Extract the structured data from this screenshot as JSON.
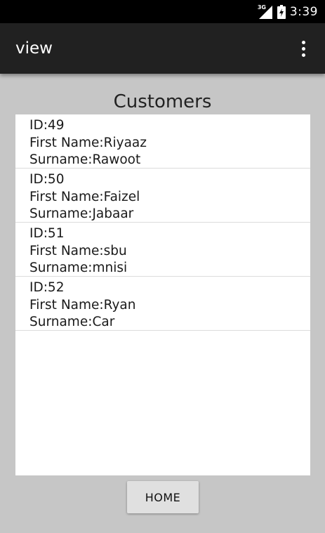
{
  "status_bar": {
    "network_type": "3G",
    "time": "3:39",
    "icons": [
      "signal-icon",
      "battery-charging-icon"
    ]
  },
  "action_bar": {
    "title": "view",
    "overflow_icon": "more-vert-icon"
  },
  "main": {
    "heading": "Customers",
    "customers": [
      {
        "id": "ID:49",
        "first_name": "First Name:Riyaaz",
        "surname": "Surname:Rawoot"
      },
      {
        "id": "ID:50",
        "first_name": "First Name:Faizel",
        "surname": "Surname:Jabaar"
      },
      {
        "id": "ID:51",
        "first_name": "First Name:sbu",
        "surname": "Surname:mnisi"
      },
      {
        "id": "ID:52",
        "first_name": "First Name:Ryan",
        "surname": "Surname:Car"
      }
    ],
    "home_button_label": "HOME"
  }
}
